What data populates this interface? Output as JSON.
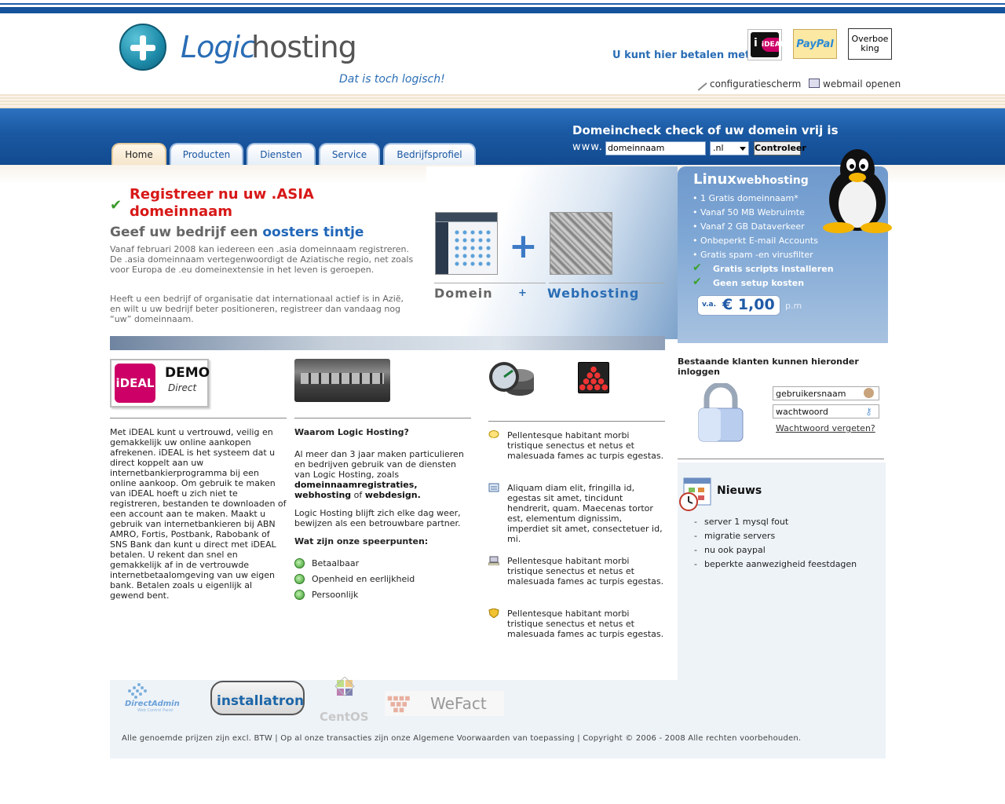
{
  "header": {
    "logo_word_1": "Logic",
    "logo_word_2": "hosting",
    "tagline": "Dat is toch logisch!",
    "pay_label": "U kunt hier betalen met:",
    "ideal_label": "iDEAL",
    "paypal_label": "PayPal",
    "overboeking_label": "Overboe king",
    "link_config": "configuratiescherm",
    "link_webmail": "webmail openen"
  },
  "nav": {
    "tabs": [
      "Home",
      "Producten",
      "Diensten",
      "Service",
      "Bedrijfsprofiel"
    ]
  },
  "domaincheck": {
    "title": "Domeincheck check of uw domein vrij is",
    "www": "www.",
    "input_value": "domeinnaam",
    "tld": ".nl",
    "button": "Controleer"
  },
  "hero": {
    "title": "Registreer nu uw .ASIA domeinnaam",
    "sub_part1": "Geef uw bedrijf een ",
    "sub_part2": "oosters tintje",
    "p1": "Vanaf februari 2008 kan iedereen een .asia domeinnaam registreren. De .asia domeinnaam vertegenwoordigt de Aziatische regio, net zoals voor Europa de .eu domeinextensie in het leven is geroepen.",
    "p2": "Heeft u een bedrijf of organisatie dat internationaal actief is in Azië, en wilt u uw bedrijf beter positioneren, registreer dan vandaag nog “uw” domeinnaam.",
    "domain_label": "Domein",
    "plus_label": "+",
    "webhosting_label": "Webhosting"
  },
  "linux": {
    "title_bold": "Linux",
    "title_rest": "webhosting",
    "items": [
      "• 1 Gratis domeinnaam*",
      "• Vanaf 50 MB Webruimte",
      "• Vanaf 2 GB Dataverkeer",
      "• Onbeperkt E-mail Accounts",
      "• Gratis spam -en virusfilter"
    ],
    "bold_items": [
      "Gratis scripts installeren",
      "Geen setup kosten"
    ],
    "price_va": "v.a.",
    "price": "€ 1,00",
    "price_pm": "p.m"
  },
  "col1": {
    "demo_text": "DEMO",
    "demo_sub": "Direct",
    "badge": "iDEAL",
    "text": "Met iDEAL kunt u vertrouwd, veilig en gemakkelijk uw online aankopen afrekenen. iDEAL is het systeem dat u direct koppelt aan uw internetbankierprogramma bij een online aankoop. Om gebruik te maken van iDEAL hoeft u zich niet te registreren, bestanden te downloaden of een account aan te maken. Maakt u gebruik van internetbankieren bij ABN AMRO, Fortis, Postbank, Rabobank of SNS Bank dan kunt u direct met iDEAL betalen. U rekent dan snel en gemakkelijk af in de vertrouwde internetbetaalomgeving van uw eigen bank. Betalen zoals u eigenlijk al gewend bent."
  },
  "col2": {
    "heading": "Waarom Logic Hosting?",
    "p1_a": "Al meer dan 3 jaar maken particulieren en bedrijven gebruik van de diensten van Logic Hosting, zoals ",
    "p1_b": "domeinnaamregistraties, webhosting",
    "p1_c": " of ",
    "p1_d": "webdesign.",
    "p2": "Logic Hosting blijft zich elke dag weer, bewijzen als een betrouwbare partner.",
    "heading2": "Wat zijn onze speerpunten:",
    "features": [
      "Betaalbaar",
      "Openheid en eerlijkheid",
      "Persoonlijk"
    ]
  },
  "col3": {
    "items": [
      "Pellentesque habitant morbi tristique senectus et netus et malesuada fames ac turpis egestas.",
      "Aliquam diam elit, fringilla id, egestas sit amet, tincidunt hendrerit, quam. Maecenas tortor est, elementum dignissim, imperdiet sit amet, consectetuer id, mi.",
      "Pellentesque habitant morbi tristique senectus et netus et malesuada fames ac turpis egestas.",
      "Pellentesque habitant morbi tristique senectus et netus et malesuada fames ac turpis egestas."
    ]
  },
  "login": {
    "title": "Bestaande klanten kunnen hieronder inloggen",
    "username": "gebruikersnaam",
    "password": "wachtwoord",
    "forgot": "Wachtwoord vergeten?"
  },
  "news": {
    "title": "Nieuws",
    "items": [
      "server 1 mysql fout",
      "migratie servers",
      "nu ook paypal",
      "beperkte aanwezigheid feestdagen"
    ]
  },
  "footer": {
    "logo_da": "DirectAdmin",
    "logo_da_sub": "Web Control Panel",
    "logo_installatron": "installatron",
    "logo_centos": "CentOS",
    "logo_wefact": "WeFact",
    "text": "Alle genoemde prijzen zijn excl. BTW | Op al onze transacties zijn onze Algemene Voorwaarden van toepassing | Copyright © 2006 - 2008 Alle rechten voorbehouden."
  },
  "colors": {
    "brand_blue": "#1b5aa4",
    "accent_red": "#d81818",
    "check_green": "#3a9a2a"
  }
}
